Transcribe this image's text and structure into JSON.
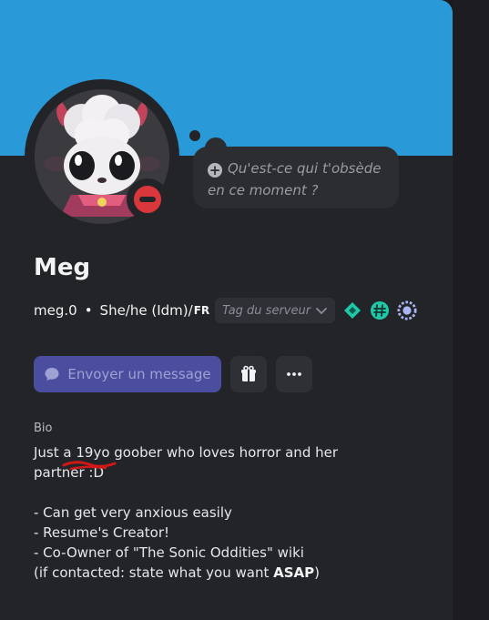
{
  "profile": {
    "display_name": "Meg",
    "username": "meg.0",
    "separator": "•",
    "pronouns": "She/he (Idm)/",
    "pronouns_flag": "FR",
    "status": "do-not-disturb"
  },
  "note": {
    "placeholder_line1": "Qu'est-ce qui t'obsède",
    "placeholder_line2": "en ce moment ?",
    "icon": "plus-circle-icon"
  },
  "server_tag": {
    "placeholder": "Tag du serveur",
    "icon": "chevron-down-icon"
  },
  "badges": [
    "nitro-diamond-icon",
    "hashtag-badge-icon",
    "laurel-badge-icon"
  ],
  "actions": {
    "message_label": "Envoyer un message",
    "message_icon": "chat-bubble-icon",
    "gift_icon": "gift-icon",
    "more_icon": "more-dots-icon"
  },
  "bio": {
    "label": "Bio",
    "line1": "Just a 19yo goober who loves horror and her",
    "line2": "partner :D",
    "line3": "- Can get very anxious easily",
    "line4": "- Resume's Creator!",
    "line5": "- Co-Owner of \"The Sonic Oddities\" wiki",
    "line6_prefix": "(if contacted: state what you want ",
    "line6_bold": "ASAP",
    "line6_suffix": ")"
  },
  "colors": {
    "banner": "#2a99d8",
    "card": "#232428",
    "accent_button": "#4b4e9e",
    "status_dnd": "#da373c",
    "badge_teal": "#1fc8a8",
    "badge_lavender": "#a9b6f5"
  }
}
